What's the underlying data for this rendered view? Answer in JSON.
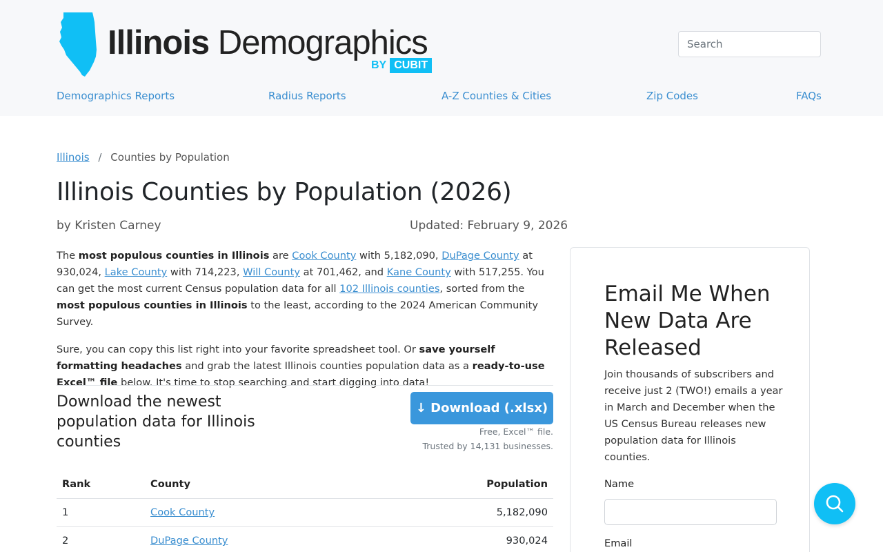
{
  "header": {
    "logo": {
      "brand_bold": "Illinois",
      "brand_rest": " Demographics",
      "by": "BY",
      "cubit": "CUBIT"
    },
    "search": {
      "placeholder": "Search",
      "value": ""
    }
  },
  "nav": [
    {
      "label": "Demographics Reports"
    },
    {
      "label": "Radius Reports"
    },
    {
      "label": "A-Z Counties & Cities"
    },
    {
      "label": "Zip Codes"
    },
    {
      "label": "FAQs"
    }
  ],
  "breadcrumb": {
    "home": "Illinois",
    "separator": "/",
    "current": "Counties by Population"
  },
  "article": {
    "title": "Illinois Counties by Population (2026)",
    "byline": "by Kristen Carney",
    "updated": "Updated: February 9, 2026",
    "p1": {
      "t1": "The ",
      "b1": "most populous counties in Illinois",
      "t2": " are ",
      "l1": "Cook County",
      "t3": " with 5,182,090, ",
      "l2": "DuPage County",
      "t4": " at 930,024, ",
      "l3": "Lake County",
      "t5": " with 714,223, ",
      "l4": "Will County",
      "t6": " at 701,462, and ",
      "l5": "Kane County",
      "t7": " with 517,255. You can get the most current Census population data for all ",
      "l6": "102 Illinois counties",
      "t8": ", sorted from the ",
      "b2": "most populous counties in Illinois",
      "t9": " to the least, according to the 2024 American Community Survey."
    },
    "p2": {
      "t1": "Sure, you can copy this list right into your favorite spreadsheet tool. Or ",
      "b1": "save yourself formatting headaches",
      "t2": " and grab the latest Illinois counties population data as a ",
      "b2": "ready-to-use Excel™ file",
      "t3": " below. It's time to stop searching and start digging into data!"
    }
  },
  "download": {
    "heading": "Download the newest population data for Illinois counties",
    "button": "↓ Download (.xlsx)",
    "note1": "Free, Excel™ file.",
    "note2": "Trusted by 14,131 businesses."
  },
  "table": {
    "headers": {
      "rank": "Rank",
      "county": "County",
      "population": "Population"
    },
    "rows": [
      {
        "rank": "1",
        "county": "Cook County",
        "population": "5,182,090"
      },
      {
        "rank": "2",
        "county": "DuPage County",
        "population": "930,024"
      }
    ]
  },
  "sidebar": {
    "title": "Email Me When New Data Are Released",
    "text": "Join thousands of subscribers and receive just 2 (TWO!) emails a year in March and December when the US Census Bureau releases new population data for Illinois counties.",
    "name_label": "Name",
    "email_label": "Email"
  },
  "colors": {
    "brand": "#10bff5",
    "link": "#3a8ed0",
    "button": "#3a97dc",
    "header_bg": "#f7f8fa"
  },
  "icons": {
    "fab": "search-icon",
    "logo": "illinois-state-shape-icon"
  }
}
